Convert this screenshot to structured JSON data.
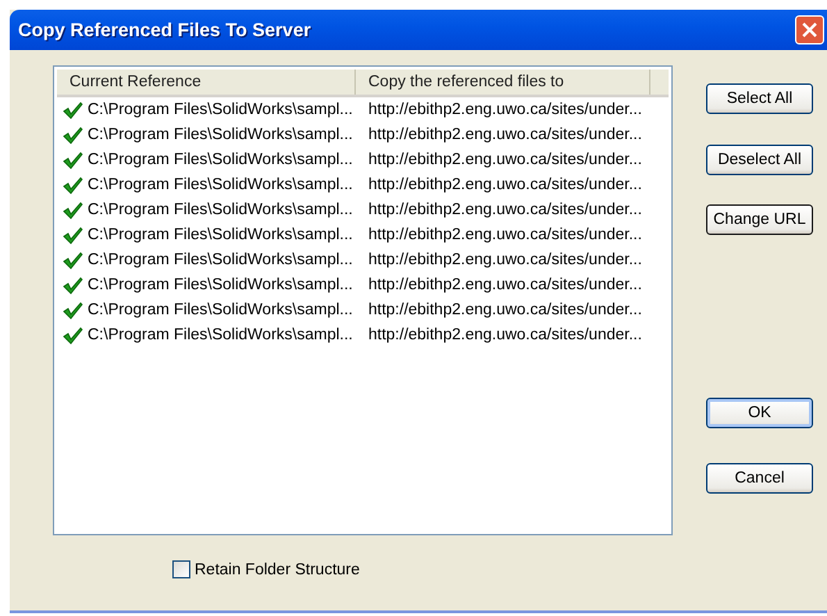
{
  "window": {
    "title": "Copy Referenced Files To Server"
  },
  "table": {
    "columns": [
      "Current Reference",
      "Copy the referenced files to"
    ],
    "rows": [
      {
        "checked": true,
        "reference": "C:\\Program Files\\SolidWorks\\sampl...",
        "destination": "http://ebithp2.eng.uwo.ca/sites/under..."
      },
      {
        "checked": true,
        "reference": "C:\\Program Files\\SolidWorks\\sampl...",
        "destination": "http://ebithp2.eng.uwo.ca/sites/under..."
      },
      {
        "checked": true,
        "reference": "C:\\Program Files\\SolidWorks\\sampl...",
        "destination": "http://ebithp2.eng.uwo.ca/sites/under..."
      },
      {
        "checked": true,
        "reference": "C:\\Program Files\\SolidWorks\\sampl...",
        "destination": "http://ebithp2.eng.uwo.ca/sites/under..."
      },
      {
        "checked": true,
        "reference": "C:\\Program Files\\SolidWorks\\sampl...",
        "destination": "http://ebithp2.eng.uwo.ca/sites/under..."
      },
      {
        "checked": true,
        "reference": "C:\\Program Files\\SolidWorks\\sampl...",
        "destination": "http://ebithp2.eng.uwo.ca/sites/under..."
      },
      {
        "checked": true,
        "reference": "C:\\Program Files\\SolidWorks\\sampl...",
        "destination": "http://ebithp2.eng.uwo.ca/sites/under..."
      },
      {
        "checked": true,
        "reference": "C:\\Program Files\\SolidWorks\\sampl...",
        "destination": "http://ebithp2.eng.uwo.ca/sites/under..."
      },
      {
        "checked": true,
        "reference": "C:\\Program Files\\SolidWorks\\sampl...",
        "destination": "http://ebithp2.eng.uwo.ca/sites/under..."
      },
      {
        "checked": true,
        "reference": "C:\\Program Files\\SolidWorks\\sampl...",
        "destination": "http://ebithp2.eng.uwo.ca/sites/under..."
      }
    ]
  },
  "side_buttons": [
    {
      "label": "Select All",
      "kind": "normal"
    },
    {
      "label": "Deselect All",
      "kind": "normal"
    },
    {
      "label": "Change URL",
      "kind": "focused"
    }
  ],
  "dialog_buttons": [
    {
      "label": "OK",
      "kind": "default"
    },
    {
      "label": "Cancel",
      "kind": "normal"
    }
  ],
  "retain_folder_structure": {
    "label": "Retain Folder Structure",
    "checked": false
  }
}
